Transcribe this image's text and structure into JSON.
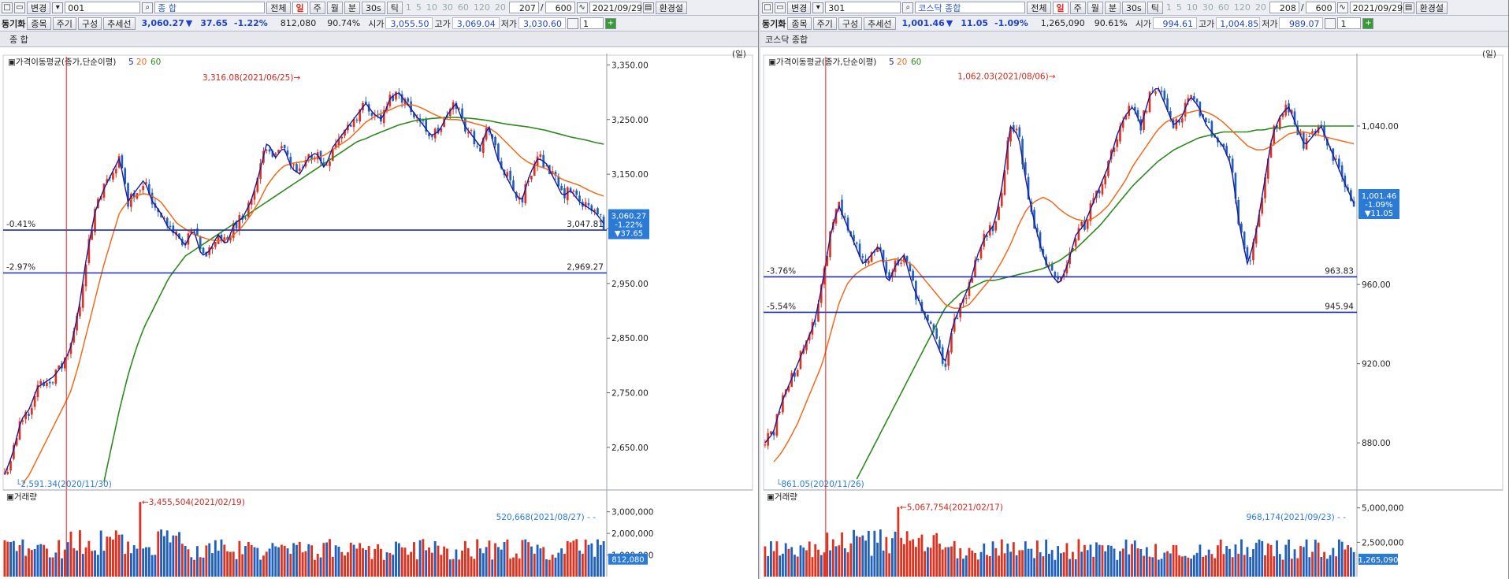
{
  "left": {
    "toolbar": {
      "change_label": "변경",
      "code": "001",
      "name": "종          합",
      "all_label": "전체",
      "periods": [
        "일",
        "주",
        "월",
        "분",
        "30s",
        "틱"
      ],
      "minute_opts": [
        "1",
        "5",
        "10",
        "30",
        "60",
        "120",
        "20"
      ],
      "count": "207",
      "total": "600",
      "date": "2021/09/29",
      "env_label": "환경설"
    },
    "quote": {
      "sync_label": "동기화",
      "item_btn": "종목",
      "cycle_btn": "주기",
      "compose_btn": "구성",
      "trend_btn": "추세선",
      "price": "3,060.27",
      "arrow": "▼",
      "change": "37.65",
      "pct": "-1.22%",
      "volume": "812,080",
      "ratio": "90.74%",
      "open_label": "시가",
      "open": "3,055.50",
      "high_label": "고가",
      "high": "3,069.04",
      "low_label": "저가",
      "low": "3,030.60",
      "spin": "1"
    },
    "title": "종      합",
    "unit": "(일)"
  },
  "right": {
    "toolbar": {
      "change_label": "변경",
      "code": "301",
      "name": "코스닥 종합",
      "all_label": "전체",
      "periods": [
        "일",
        "주",
        "월",
        "분",
        "30s",
        "틱"
      ],
      "minute_opts": [
        "1",
        "5",
        "10",
        "30",
        "60",
        "120",
        "20"
      ],
      "count": "208",
      "total": "600",
      "date": "2021/09/29",
      "env_label": "환경설"
    },
    "quote": {
      "sync_label": "동기화",
      "item_btn": "종목",
      "cycle_btn": "주기",
      "compose_btn": "구성",
      "trend_btn": "추세선",
      "price": "1,001.46",
      "arrow": "▼",
      "change": "11.05",
      "pct": "-1.09%",
      "volume": "1,265,090",
      "ratio": "90.61%",
      "open_label": "시가",
      "open": "994.61",
      "high_label": "고가",
      "high": "1,004.85",
      "low_label": "저가",
      "low": "989.07",
      "spin": "1"
    },
    "title": "코스닥 종합",
    "unit": "(일)"
  },
  "colors": {
    "up": "#e0301e",
    "down": "#1f5fc0",
    "ma5": "#1a1a9a",
    "ma20": "#f26a1b",
    "ma60": "#2d8a1e",
    "line": "#1a2fb0",
    "annot": "#d0281e",
    "cur": "#2b7ad6"
  },
  "chart_data": [
    {
      "type": "line",
      "name": "종합 price",
      "legend_title": "가격이동평균(종가,단순이평)",
      "legend_periods": [
        "5",
        "20",
        "60"
      ],
      "yticks": [
        3350,
        3250,
        3150,
        3050,
        2950,
        2850,
        2750,
        2650
      ],
      "ytick_labels": [
        "3,350.00",
        "3,250.00",
        "3,150.00",
        "3,050.00",
        "2,950.00",
        "2,850.00",
        "2,750.00",
        "2,650.00"
      ],
      "ylim": [
        2575,
        3365
      ],
      "close_path": [
        2600,
        2640,
        2700,
        2720,
        2760,
        2770,
        2780,
        2800,
        2830,
        2900,
        3000,
        3080,
        3120,
        3150,
        3180,
        3100,
        3120,
        3140,
        3100,
        3080,
        3050,
        3040,
        3020,
        3050,
        3000,
        3010,
        3040,
        3020,
        3060,
        3070,
        3100,
        3150,
        3210,
        3180,
        3200,
        3160,
        3150,
        3180,
        3190,
        3160,
        3200,
        3220,
        3240,
        3260,
        3280,
        3260,
        3250,
        3290,
        3300,
        3280,
        3260,
        3240,
        3220,
        3230,
        3260,
        3280,
        3240,
        3220,
        3200,
        3240,
        3180,
        3150,
        3120,
        3100,
        3150,
        3180,
        3170,
        3140,
        3110,
        3120,
        3100,
        3090,
        3080,
        3060
      ],
      "ma20_path": [
        null,
        null,
        2580,
        2600,
        2630,
        2660,
        2690,
        2720,
        2750,
        2800,
        2860,
        2920,
        2980,
        3030,
        3080,
        3100,
        3110,
        3115,
        3110,
        3100,
        3080,
        3060,
        3050,
        3040,
        3035,
        3030,
        3028,
        3030,
        3040,
        3055,
        3075,
        3100,
        3130,
        3150,
        3165,
        3170,
        3172,
        3175,
        3180,
        3185,
        3195,
        3205,
        3215,
        3230,
        3245,
        3255,
        3262,
        3268,
        3275,
        3278,
        3276,
        3270,
        3262,
        3255,
        3250,
        3250,
        3248,
        3244,
        3240,
        3235,
        3225,
        3210,
        3195,
        3180,
        3170,
        3165,
        3160,
        3150,
        3140,
        3135,
        3130,
        3122,
        3115,
        3110
      ],
      "ma60_path": [
        null,
        null,
        null,
        null,
        null,
        null,
        null,
        null,
        null,
        null,
        null,
        null,
        2580,
        2650,
        2720,
        2780,
        2830,
        2870,
        2900,
        2930,
        2960,
        2980,
        3000,
        3010,
        3020,
        3030,
        3040,
        3050,
        3060,
        3070,
        3080,
        3090,
        3100,
        3110,
        3120,
        3130,
        3140,
        3150,
        3160,
        3170,
        3180,
        3190,
        3200,
        3210,
        3215,
        3222,
        3228,
        3234,
        3240,
        3244,
        3248,
        3250,
        3252,
        3253,
        3254,
        3254,
        3253,
        3252,
        3250,
        3248,
        3245,
        3242,
        3240,
        3238,
        3236,
        3233,
        3230,
        3226,
        3222,
        3218,
        3215,
        3212,
        3208,
        3205
      ],
      "hlines": [
        {
          "pct": "-0.41%",
          "value": 3047.81,
          "label": "3,047.81"
        },
        {
          "pct": "-2.97%",
          "value": 2969.27,
          "label": "2,969.27"
        }
      ],
      "annotations": [
        {
          "text": "3,316.08(2021/06/25)",
          "value": 3316.08,
          "kind": "high"
        },
        {
          "text": "2,591.34(2020/11/30)",
          "value": 2591.34,
          "kind": "low"
        }
      ],
      "current": {
        "price": "3,060.27",
        "change": "-1.22%",
        "delta": "▼37.65"
      }
    },
    {
      "type": "bar",
      "name": "종합 volume",
      "title": "거래량",
      "yticks": [
        3000000,
        2000000,
        1000000
      ],
      "ytick_labels": [
        "3,000,000",
        "2,000,000",
        "1,000,000"
      ],
      "ylim": [
        0,
        3500000
      ],
      "annotations": [
        {
          "text": "3,455,504(2021/02/19)",
          "value": 3455504
        },
        {
          "text": "520,668(2021/08/27)",
          "value": 520668
        }
      ],
      "current": "812,080"
    },
    {
      "type": "line",
      "name": "코스닥 price",
      "legend_title": "가격이동평균(종가,단순이평)",
      "legend_periods": [
        "5",
        "20",
        "60"
      ],
      "yticks": [
        1040,
        960,
        920,
        880
      ],
      "ytick_labels": [
        "1,040.00",
        "960.00",
        "920.00",
        "880.00"
      ],
      "ylim": [
        857,
        1075
      ],
      "close_path": [
        880,
        885,
        900,
        910,
        920,
        930,
        940,
        960,
        985,
        1000,
        990,
        980,
        970,
        975,
        980,
        960,
        970,
        975,
        960,
        950,
        940,
        930,
        920,
        940,
        950,
        960,
        975,
        985,
        990,
        1010,
        1040,
        1035,
        1010,
        990,
        975,
        965,
        960,
        970,
        985,
        990,
        1000,
        1010,
        1020,
        1035,
        1045,
        1050,
        1040,
        1055,
        1060,
        1050,
        1040,
        1045,
        1055,
        1050,
        1040,
        1035,
        1030,
        1020,
        990,
        970,
        985,
        1010,
        1035,
        1045,
        1050,
        1040,
        1030,
        1035,
        1040,
        1030,
        1020,
        1010,
        1001
      ],
      "ma20_path": [
        null,
        870,
        875,
        882,
        890,
        900,
        910,
        920,
        935,
        950,
        960,
        965,
        968,
        970,
        972,
        972,
        973,
        972,
        970,
        965,
        960,
        955,
        950,
        948,
        948,
        950,
        955,
        960,
        965,
        972,
        980,
        990,
        998,
        1002,
        1004,
        1002,
        998,
        995,
        993,
        992,
        993,
        996,
        1000,
        1006,
        1012,
        1020,
        1026,
        1032,
        1038,
        1042,
        1044,
        1046,
        1047,
        1048,
        1047,
        1045,
        1042,
        1038,
        1034,
        1030,
        1028,
        1028,
        1030,
        1033,
        1036,
        1037,
        1037,
        1036,
        1035,
        1034,
        1033,
        1032,
        1031
      ],
      "ma60_path": [
        null,
        null,
        null,
        null,
        null,
        null,
        null,
        null,
        null,
        null,
        null,
        860,
        868,
        876,
        884,
        892,
        900,
        908,
        916,
        924,
        932,
        940,
        948,
        952,
        956,
        958,
        960,
        962,
        962,
        963,
        964,
        965,
        966,
        967,
        968,
        970,
        972,
        975,
        978,
        982,
        986,
        990,
        995,
        1000,
        1005,
        1010,
        1014,
        1018,
        1022,
        1025,
        1028,
        1030,
        1032,
        1034,
        1035,
        1036,
        1037,
        1037,
        1037,
        1037,
        1038,
        1038,
        1039,
        1039,
        1040,
        1040,
        1040,
        1040,
        1040,
        1040,
        1040,
        1040,
        1040
      ],
      "hlines": [
        {
          "pct": "-3.76%",
          "value": 963.83,
          "label": "963.83"
        },
        {
          "pct": "-5.54%",
          "value": 945.94,
          "label": "945.94"
        }
      ],
      "annotations": [
        {
          "text": "1,062.03(2021/08/06)",
          "value": 1062.03,
          "kind": "high"
        },
        {
          "text": "861.05(2020/11/26)",
          "value": 861.05,
          "kind": "low"
        }
      ],
      "current": {
        "price": "1,001.46",
        "change": "-1.09%",
        "delta": "▼11.05"
      }
    },
    {
      "type": "bar",
      "name": "코스닥 volume",
      "title": "거래량",
      "yticks": [
        5000000,
        2500000
      ],
      "ytick_labels": [
        "5,000,000",
        "2,500,000"
      ],
      "ylim": [
        0,
        5500000
      ],
      "annotations": [
        {
          "text": "5,067,754(2021/02/17)",
          "value": 5067754
        },
        {
          "text": "968,174(2021/09/23)",
          "value": 968174
        }
      ],
      "current": "1,265,090"
    }
  ]
}
